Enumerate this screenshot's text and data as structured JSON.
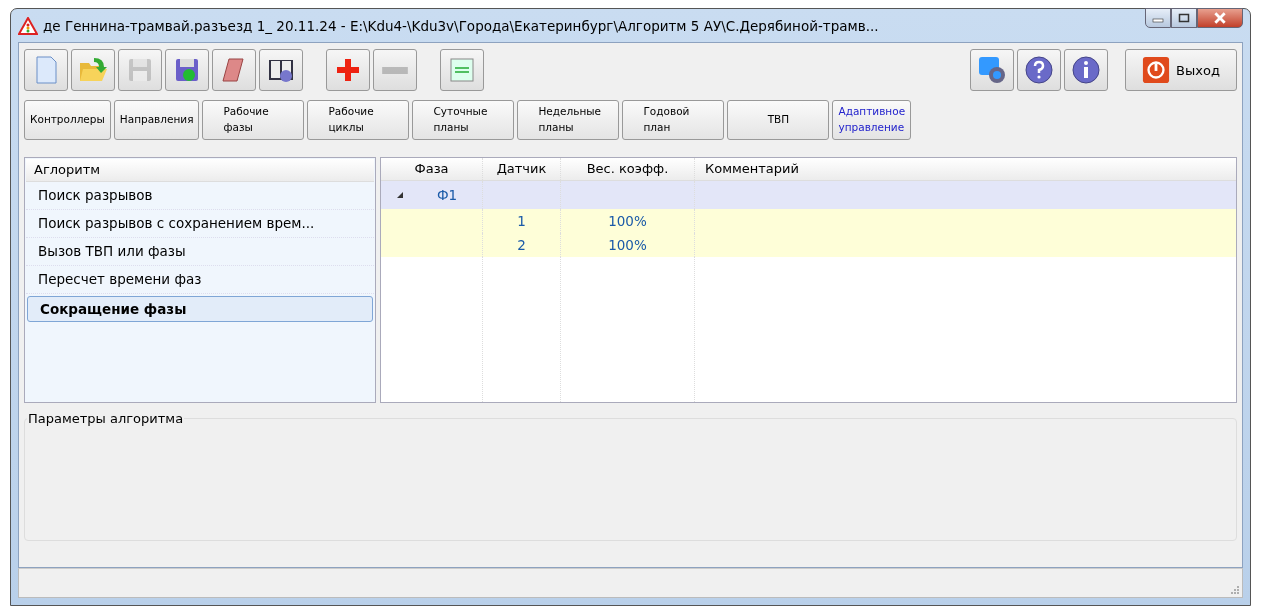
{
  "window": {
    "title": "де Геннина-трамвай.разъезд 1_ 20.11.24 - E:\\Kdu4-\\Kdu3v\\Города\\Екатеринбург\\Алгоритм 5 АУ\\С.Дерябиной-трамв..."
  },
  "toolbar": [
    {
      "kind": "new",
      "disabled": false
    },
    {
      "kind": "open",
      "disabled": false
    },
    {
      "kind": "save",
      "disabled": true
    },
    {
      "kind": "save-as",
      "disabled": false
    },
    {
      "kind": "erase",
      "disabled": false
    },
    {
      "kind": "book",
      "disabled": false
    },
    {
      "kind": "add",
      "disabled": false,
      "gap": true
    },
    {
      "kind": "remove",
      "disabled": true
    },
    {
      "kind": "board",
      "disabled": false,
      "gap": true
    }
  ],
  "toolbar_right": [
    {
      "kind": "settings"
    },
    {
      "kind": "help"
    },
    {
      "kind": "info"
    }
  ],
  "exit_button": {
    "label": "Выход"
  },
  "tabs": [
    {
      "label": "Контроллеры",
      "selected": false
    },
    {
      "label": "Направления",
      "selected": false
    },
    {
      "label": "Рабочие\nфазы",
      "selected": false
    },
    {
      "label": "Рабочие\nциклы",
      "selected": false
    },
    {
      "label": "Суточные\nпланы",
      "selected": false
    },
    {
      "label": "Недельные\nпланы",
      "selected": false
    },
    {
      "label": "Годовой\nплан",
      "selected": false
    },
    {
      "label": "ТВП",
      "selected": false
    },
    {
      "label": "Адаптивное\nуправление",
      "selected": true
    }
  ],
  "algorithms": {
    "header": "Аглоритм",
    "items": [
      {
        "label": "Поиск разрывов",
        "selected": false
      },
      {
        "label": "Поиск разрывов с сохранением врем...",
        "selected": false
      },
      {
        "label": "Вызов ТВП или фазы",
        "selected": false
      },
      {
        "label": "Пересчет времени фаз",
        "selected": false
      },
      {
        "label": "Сокращение фазы",
        "selected": true
      }
    ]
  },
  "table": {
    "columns": [
      "Фаза",
      "Датчик",
      "Вес. коэфф.",
      "Комментарий"
    ],
    "groups": [
      {
        "phase": "Ф1",
        "expanded": true,
        "children": [
          {
            "sensor": "1",
            "weight": "100%"
          },
          {
            "sensor": "2",
            "weight": "100%"
          }
        ]
      }
    ]
  },
  "params": {
    "title": "Параметры алгоритма"
  }
}
